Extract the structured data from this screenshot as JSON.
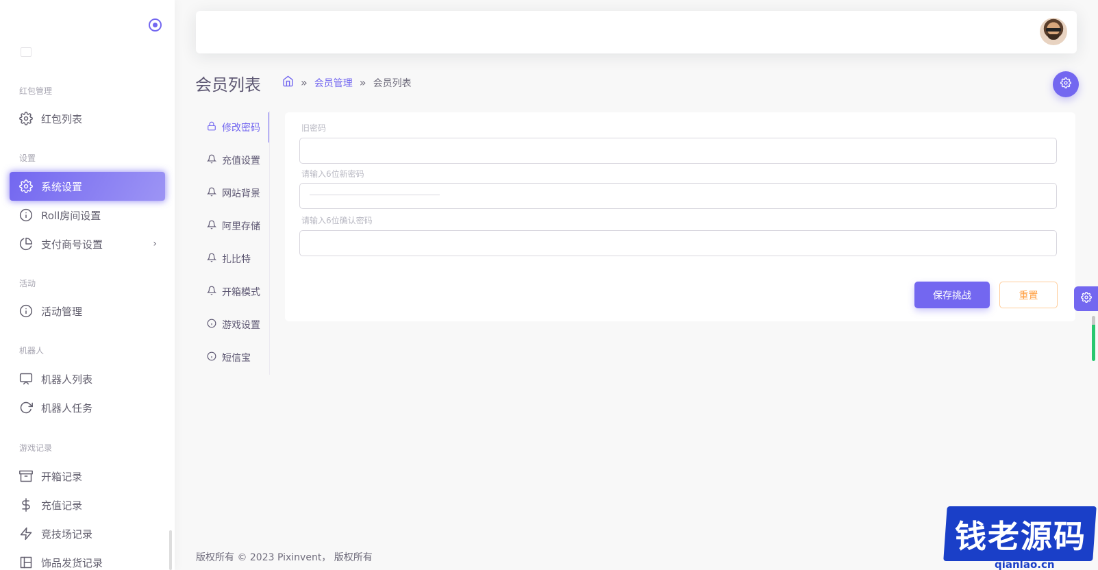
{
  "sidebar": {
    "sections": [
      {
        "title": "红包管理",
        "items": [
          {
            "label": "红包列表",
            "icon": "gear-icon"
          }
        ]
      },
      {
        "title": "设置",
        "items": [
          {
            "label": "系统设置",
            "icon": "gear-icon",
            "active": true
          },
          {
            "label": "Roll房间设置",
            "icon": "info-icon"
          },
          {
            "label": "支付商号设置",
            "icon": "pie-chart-icon",
            "chevron": "›"
          }
        ]
      },
      {
        "title": "活动",
        "items": [
          {
            "label": "活动管理",
            "icon": "info-icon"
          }
        ]
      },
      {
        "title": "机器人",
        "items": [
          {
            "label": "机器人列表",
            "icon": "monitor-icon"
          },
          {
            "label": "机器人任务",
            "icon": "refresh-icon"
          }
        ]
      },
      {
        "title": "游戏记录",
        "items": [
          {
            "label": "开箱记录",
            "icon": "archive-icon"
          },
          {
            "label": "充值记录",
            "icon": "dollar-icon"
          },
          {
            "label": "竞技场记录",
            "icon": "zap-icon"
          },
          {
            "label": "饰品发货记录",
            "icon": "grid-icon"
          }
        ]
      }
    ]
  },
  "header": {
    "title": "会员列表",
    "breadcrumb": {
      "link": "会员管理",
      "sep": "»",
      "current": "会员列表"
    }
  },
  "tabs": [
    {
      "label": "修改密码",
      "icon": "lock-icon",
      "active": true
    },
    {
      "label": "充值设置",
      "icon": "bell-icon"
    },
    {
      "label": "网站背景",
      "icon": "bell-icon"
    },
    {
      "label": "阿里存储",
      "icon": "bell-icon"
    },
    {
      "label": "扎比特",
      "icon": "bell-icon"
    },
    {
      "label": "开箱模式",
      "icon": "bell-icon"
    },
    {
      "label": "游戏设置",
      "icon": "info-icon"
    },
    {
      "label": "短信宝",
      "icon": "info-icon"
    }
  ],
  "form": {
    "old_password_label": "旧密码",
    "new_password_label": "请输入6位新密码",
    "confirm_password_label": "请输入6位确认密码",
    "save_label": "保存挑战",
    "reset_label": "重置"
  },
  "footer": {
    "text": "版权所有 © 2023 Pixinvent，  版权所有"
  },
  "watermark": {
    "text": "钱老源码",
    "url": "qianlao.cn"
  },
  "colors": {
    "primary": "#7367f0",
    "warning": "#ff9f43",
    "success": "#28c76f"
  }
}
